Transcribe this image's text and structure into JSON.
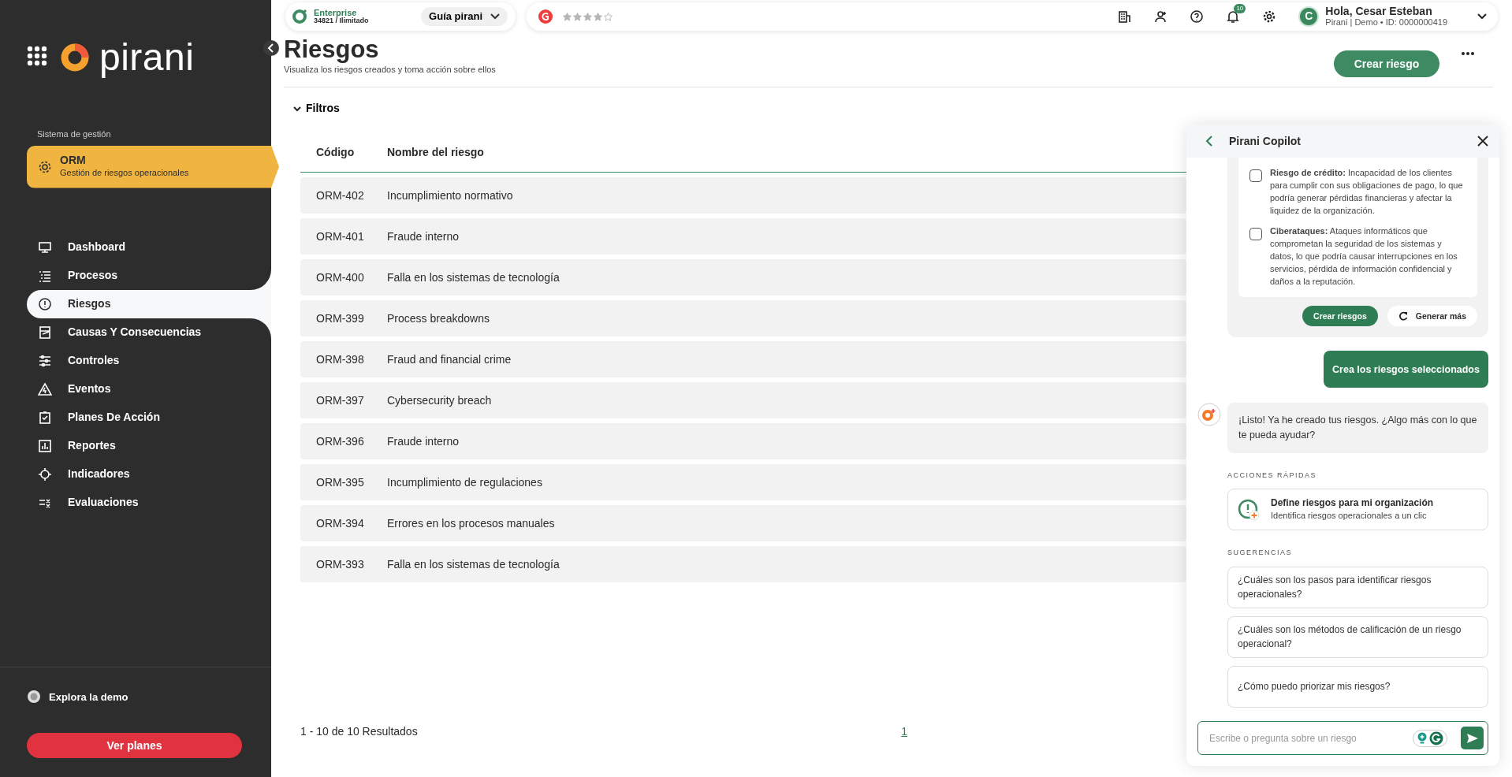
{
  "sidebar": {
    "logo_text": "pirani",
    "section_label": "Sistema de gestión",
    "module": {
      "title": "ORM",
      "subtitle": "Gestión de riesgos operacionales"
    },
    "nav": [
      {
        "label": "Dashboard",
        "selected": false
      },
      {
        "label": "Procesos",
        "selected": false
      },
      {
        "label": "Riesgos",
        "selected": true
      },
      {
        "label": "Causas Y Consecuencias",
        "selected": false
      },
      {
        "label": "Controles",
        "selected": false
      },
      {
        "label": "Eventos",
        "selected": false
      },
      {
        "label": "Planes De Acción",
        "selected": false
      },
      {
        "label": "Reportes",
        "selected": false
      },
      {
        "label": "Indicadores",
        "selected": false
      },
      {
        "label": "Evaluaciones",
        "selected": false
      }
    ],
    "demo_link": "Explora la demo",
    "plans_button": "Ver planes"
  },
  "topbar": {
    "plan": {
      "name": "Enterprise",
      "detail": "34821 / Ilimitado"
    },
    "guide_dropdown": "Guía pirani",
    "rating": {
      "stars": 4
    },
    "notifications_badge": "10",
    "avatar_initial": "C",
    "greeting": "Hola, Cesar Esteban",
    "account": "Pirani | Demo • ID: 0000000419"
  },
  "page": {
    "title": "Riesgos",
    "subtitle": "Visualiza los riesgos creados y toma acción sobre ellos",
    "create_button": "Crear riesgo",
    "filters_label": "Filtros",
    "filters_expanded": true
  },
  "table": {
    "columns": [
      "Código",
      "Nombre del riesgo"
    ],
    "rows": [
      {
        "code": "ORM-402",
        "name": "Incumplimiento normativo"
      },
      {
        "code": "ORM-401",
        "name": "Fraude interno"
      },
      {
        "code": "ORM-400",
        "name": "Falla en los sistemas de tecnología"
      },
      {
        "code": "ORM-399",
        "name": "Process breakdowns"
      },
      {
        "code": "ORM-398",
        "name": "Fraud and financial crime"
      },
      {
        "code": "ORM-397",
        "name": "Cybersecurity breach"
      },
      {
        "code": "ORM-396",
        "name": "Fraude interno"
      },
      {
        "code": "ORM-395",
        "name": "Incumplimiento de regulaciones"
      },
      {
        "code": "ORM-394",
        "name": "Errores en los procesos manuales"
      },
      {
        "code": "ORM-393",
        "name": "Falla en los sistemas de tecnología"
      }
    ]
  },
  "pagination": {
    "summary": "1 - 10 de 10 Resultados",
    "pages": [
      {
        "label": "1",
        "selected": true
      }
    ]
  },
  "copilot": {
    "title": "Pirani Copilot",
    "messages": [
      {
        "kind": "proposal",
        "items": [
          {
            "text": "**Riesgo de crédito:**  Incapacidad de los clientes para cumplir con sus obligaciones de pago, lo que podría generar pérdidas financieras y afectar la liquidez de la organización.",
            "checked": false
          },
          {
            "text": "**Ciberataques:**  Ataques informáticos que comprometan la seguridad de los sistemas y datos, lo que podría causar interrupciones en los servicios, pérdida de información confidencial y daños a la reputación.",
            "checked": false
          }
        ],
        "primary_button": "Crear riesgos",
        "secondary_button": "Generar más"
      },
      {
        "kind": "user",
        "text": "Crea los riesgos seleccionados"
      },
      {
        "kind": "bot",
        "text": "¡Listo!  Ya he creado tus riesgos. ¿Algo más con lo que te pueda ayudar?"
      }
    ],
    "quick_actions_label": "ACCIONES RÁPIDAS",
    "quick_actions": [
      {
        "title": "Define riesgos para mi organización",
        "subtitle": "Identifica riesgos operacionales a un clic"
      }
    ],
    "suggestions_label": "SUGERENCIAS",
    "suggestions": [
      "¿Cuáles son los pasos para identificar riesgos operacionales?",
      "¿Cuáles son los métodos de calificación de un riesgo operacional?",
      "¿Cómo puedo priorizar mis riesgos?"
    ],
    "input": {
      "placeholder": "Escribe o pregunta sobre un riesgo"
    }
  }
}
